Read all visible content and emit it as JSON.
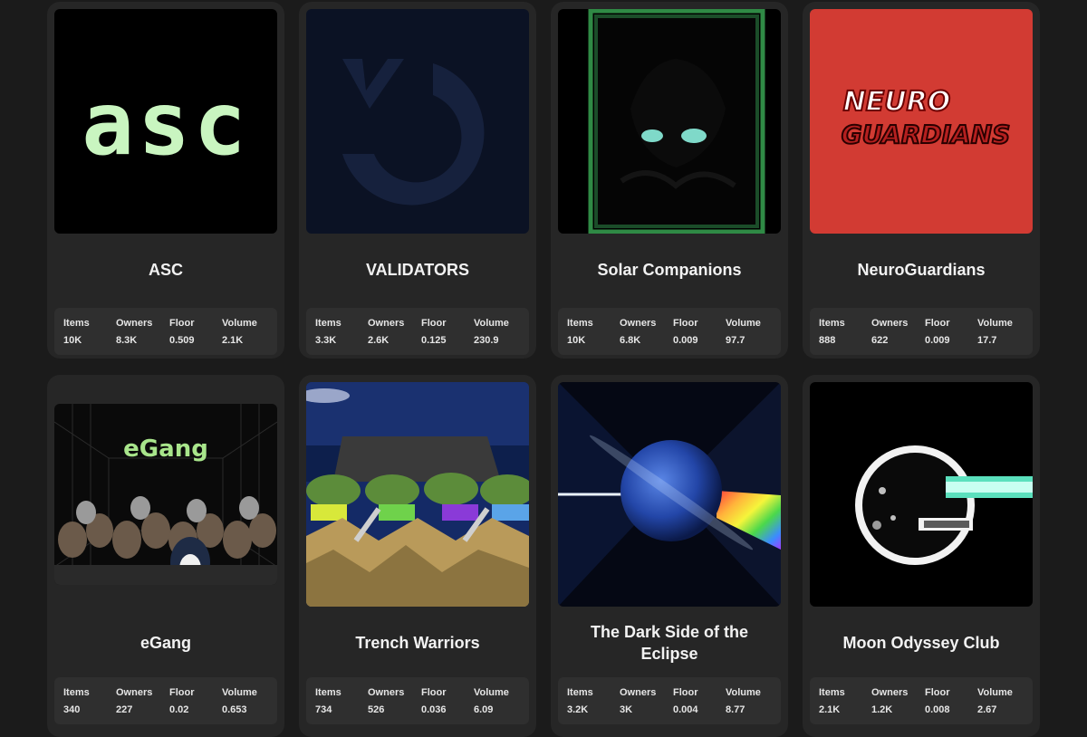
{
  "stat_labels": {
    "items": "Items",
    "owners": "Owners",
    "floor": "Floor",
    "volume": "Volume"
  },
  "collections": [
    {
      "name": "ASC",
      "image_text": "asc",
      "items": "10K",
      "owners": "8.3K",
      "floor": "0.509",
      "volume": "2.1K"
    },
    {
      "name": "VALIDATORS",
      "items": "3.3K",
      "owners": "2.6K",
      "floor": "0.125",
      "volume": "230.9"
    },
    {
      "name": "Solar Companions",
      "items": "10K",
      "owners": "6.8K",
      "floor": "0.009",
      "volume": "97.7"
    },
    {
      "name": "NeuroGuardians",
      "image_text": [
        "NEURO",
        "GUARDIANS"
      ],
      "items": "888",
      "owners": "622",
      "floor": "0.009",
      "volume": "17.7"
    },
    {
      "name": "eGang",
      "image_text": "eGang",
      "items": "340",
      "owners": "227",
      "floor": "0.02",
      "volume": "0.653"
    },
    {
      "name": "Trench Warriors",
      "items": "734",
      "owners": "526",
      "floor": "0.036",
      "volume": "6.09"
    },
    {
      "name": "The Dark Side of the Eclipse",
      "items": "3.2K",
      "owners": "3K",
      "floor": "0.004",
      "volume": "8.77"
    },
    {
      "name": "Moon Odyssey Club",
      "items": "2.1K",
      "owners": "1.2K",
      "floor": "0.008",
      "volume": "2.67"
    }
  ],
  "colors": {
    "page_bg": "#1b1b1b",
    "card_bg": "#262626",
    "stats_bg": "#2f2f2f",
    "asc_green": "#c9f5c0",
    "neuro_red": "#d23b33"
  }
}
